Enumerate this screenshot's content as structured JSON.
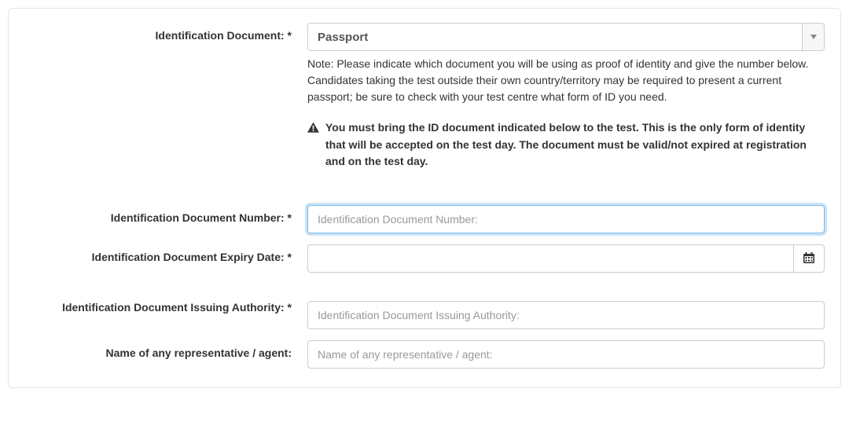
{
  "fields": {
    "id_doc": {
      "label": "Identification Document: *",
      "selected": "Passport",
      "note": "Note: Please indicate which document you will be using as proof of identity and give the number below. Candidates taking the test outside their own country/territory may be required to present a current passport; be sure to check with your test centre what form of ID you need.",
      "warning": "You must bring the ID document indicated below to the test. This is the only form of identity that will be accepted on the test day. The document must be valid/not expired at registration and on the test day."
    },
    "id_number": {
      "label": "Identification Document Number: *",
      "placeholder": "Identification Document Number:",
      "value": ""
    },
    "id_expiry": {
      "label": "Identification Document Expiry Date: *",
      "value": ""
    },
    "id_authority": {
      "label": "Identification Document Issuing Authority: *",
      "placeholder": "Identification Document Issuing Authority:",
      "value": ""
    },
    "representative": {
      "label": "Name of any representative / agent:",
      "placeholder": "Name of any representative / agent:",
      "value": ""
    }
  }
}
